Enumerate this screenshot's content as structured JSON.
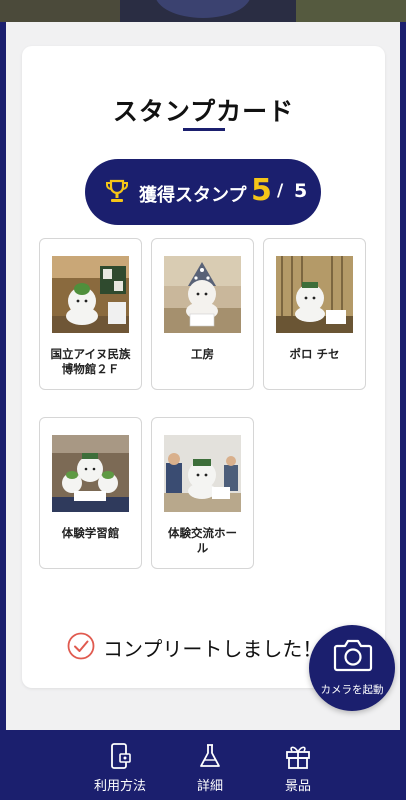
{
  "card": {
    "title": "スタンプカード"
  },
  "earned": {
    "label": "獲得スタンプ",
    "count": "5",
    "separator": "/",
    "total": "5",
    "icon": "trophy-icon"
  },
  "stamps": [
    {
      "name": "国立アイヌ民族\n博物館２Ｆ",
      "collected": true
    },
    {
      "name": "工房",
      "collected": true
    },
    {
      "name": "ポロ チセ",
      "collected": true
    },
    {
      "name": "体験学習館",
      "collected": true
    },
    {
      "name": "体験交流ホー\nル",
      "collected": true
    }
  ],
  "complete": {
    "text": "コンプリートしました！",
    "icon": "check-circle-icon"
  },
  "camera_button": {
    "label": "カメラを起動",
    "icon": "camera-icon"
  },
  "bottom_nav": [
    {
      "label": "利用方法",
      "icon": "phone-guide-icon"
    },
    {
      "label": "詳細",
      "icon": "flask-icon"
    },
    {
      "label": "景品",
      "icon": "gift-icon"
    }
  ],
  "colors": {
    "brand_navy": "#1b1f6e",
    "accent_yellow": "#f5c518",
    "check_red": "#e05a4f"
  }
}
